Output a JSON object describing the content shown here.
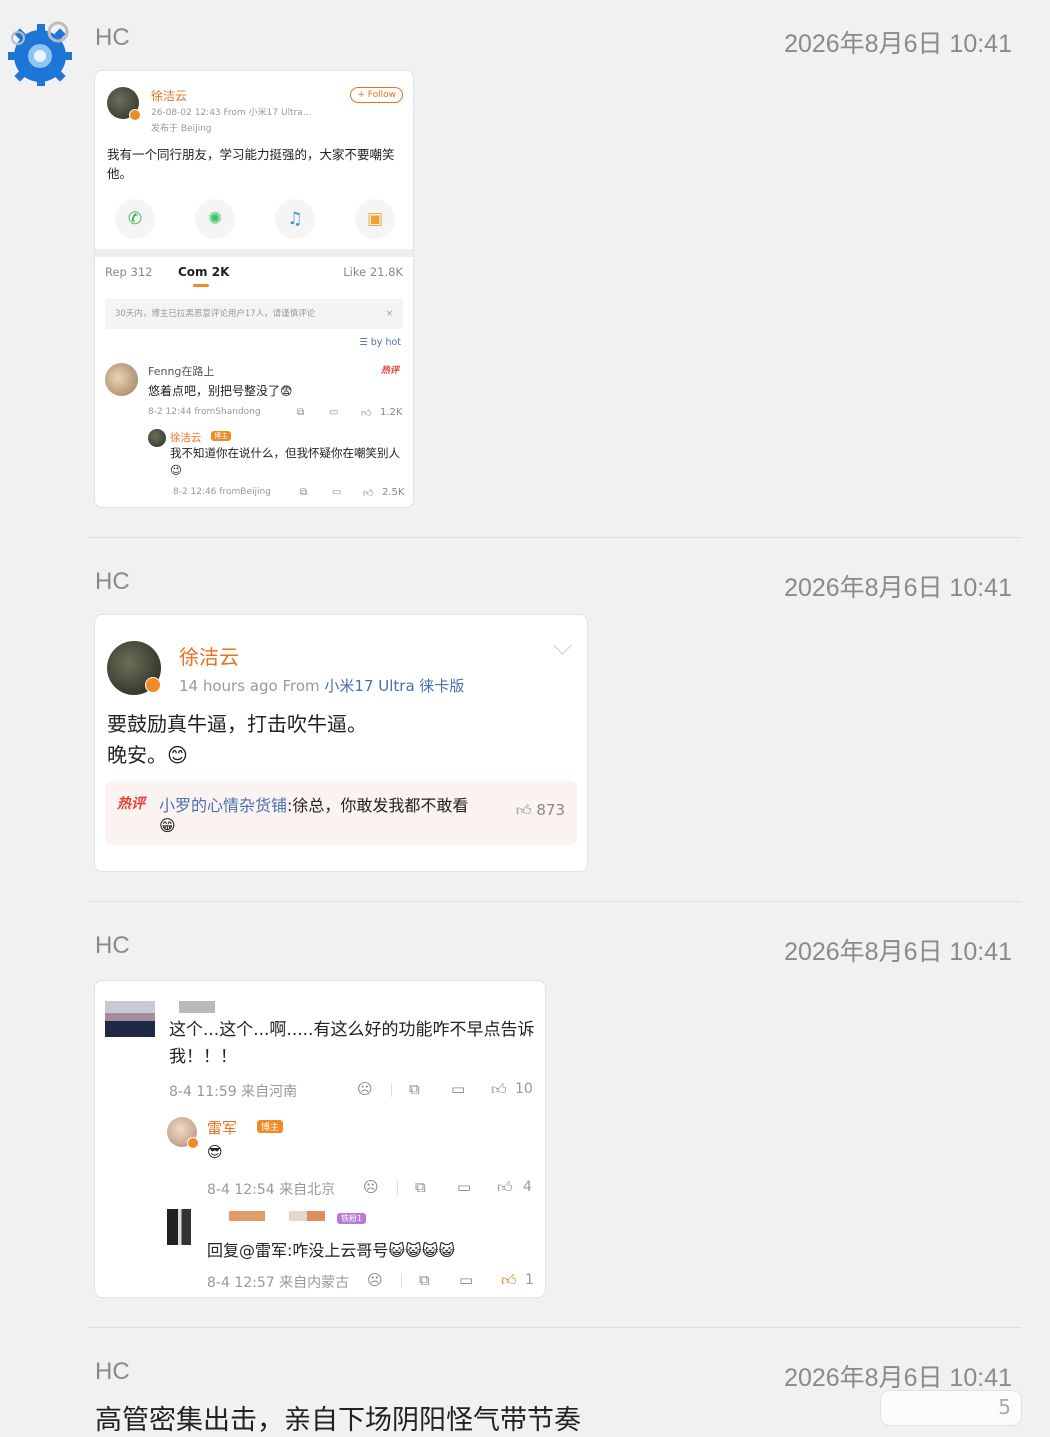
{
  "messages": [
    {
      "sender": "HC",
      "time": "2026年8月6日 10:41"
    },
    {
      "sender": "HC",
      "time": "2026年8月6日 10:41"
    },
    {
      "sender": "HC",
      "time": "2026年8月6日 10:41"
    },
    {
      "sender": "HC",
      "time": "2026年8月6日 10:41",
      "text": "高管密集出击，亲自下场阴阳怪气带节奏"
    }
  ],
  "card1": {
    "author": "徐洁云",
    "meta": "26-08-02 12:43  From 小米17 Ultra...",
    "location": "发布于 Beijing",
    "follow": "+ Follow",
    "text": "我有一个同行朋友，学习能力挺强的，大家不要嘲笑他。",
    "tabs": {
      "rep": "Rep 312",
      "com": "Com 2K",
      "like": "Like 21.8K"
    },
    "notice": "30天内，博主已拉黑恶意评论用户17人，请谨慎评论",
    "sort": "by hot",
    "comment": {
      "user": "Fenng在路上",
      "hot": "热评",
      "text": "悠着点吧，别把号整没了😨",
      "meta": "8-2 12:44 fromShandong",
      "likes": "1.2K"
    },
    "reply": {
      "user": "徐洁云",
      "badge": "博主",
      "text": "我不知道你在说什么，但我怀疑你在嘲笑别人😉",
      "meta": "8-2 12:46 fromBeijing",
      "likes": "2.5K"
    }
  },
  "card2": {
    "author": "徐洁云",
    "meta_time": "14 hours ago",
    "meta_from": "From",
    "meta_source": "小米17 Ultra 徕卡版",
    "line1": "要鼓励真牛逼，打击吹牛逼。",
    "line2": "晚安。😊",
    "hot_label": "热评",
    "hot_user": "小罗的心情杂货铺",
    "hot_text": ":徐总，你敢发我都不敢看",
    "hot_emoji": "😁",
    "hot_likes": "873"
  },
  "card3": {
    "text": "这个...这个...啊.....有这么好的功能咋不早点告诉我！！！",
    "meta1": "8-4 11:59  来自河南",
    "likes1": "10",
    "reply_user": "雷军",
    "reply_badge": "博主",
    "reply_emoji": "😎",
    "meta2": "8-4 12:54  来自北京",
    "likes2": "4",
    "badge3": "铁粉1",
    "reply2": "回复@雷军:咋没上云哥号😺😺😺😺",
    "meta3": "8-4 12:57  来自内蒙古",
    "likes3": "1"
  },
  "pill_count": "5",
  "icons": [
    "gear-avatar-icon",
    "wechat-icon",
    "moments-icon",
    "qq-icon",
    "save-icon",
    "like-icon",
    "comment-icon",
    "share-icon",
    "emoji-icon",
    "chevron-down-icon"
  ]
}
